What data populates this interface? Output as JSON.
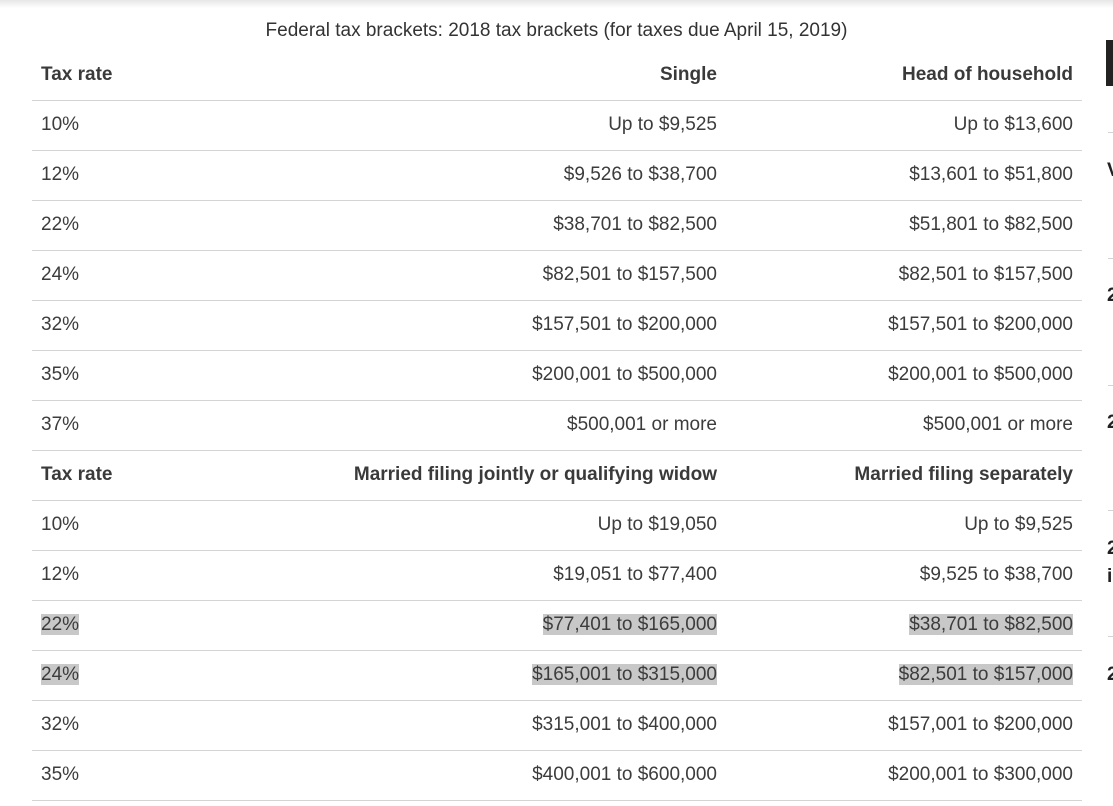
{
  "caption": "Federal tax brackets: 2018 tax brackets (for taxes due April 15, 2019)",
  "section1": {
    "headers": [
      "Tax rate",
      "Single",
      "Head of household"
    ],
    "rows": [
      [
        "10%",
        "Up to $9,525",
        "Up to $13,600"
      ],
      [
        "12%",
        "$9,526 to $38,700",
        "$13,601 to $51,800"
      ],
      [
        "22%",
        "$38,701 to $82,500",
        "$51,801 to $82,500"
      ],
      [
        "24%",
        "$82,501 to $157,500",
        "$82,501 to $157,500"
      ],
      [
        "32%",
        "$157,501 to $200,000",
        "$157,501 to $200,000"
      ],
      [
        "35%",
        "$200,001 to $500,000",
        "$200,001 to $500,000"
      ],
      [
        "37%",
        "$500,001 or more",
        "$500,001 or more"
      ]
    ]
  },
  "section2": {
    "headers": [
      "Tax rate",
      "Married filing jointly or qualifying widow",
      "Married filing separately"
    ],
    "rows": [
      [
        "10%",
        "Up to $19,050",
        "Up to $9,525"
      ],
      [
        "12%",
        "$19,051 to $77,400",
        "$9,525 to $38,700"
      ],
      [
        "22%",
        "$77,401 to $165,000",
        "$38,701 to $82,500"
      ],
      [
        "24%",
        "$165,001 to $315,000",
        "$82,501 to $157,000"
      ],
      [
        "32%",
        "$315,001 to $400,000",
        "$157,001 to $200,000"
      ],
      [
        "35%",
        "$400,001 to $600,000",
        "$200,001 to $300,000"
      ]
    ]
  },
  "colors": {
    "highlight": "#c8c8c8",
    "border": "#d4d4d4",
    "text": "#333333"
  },
  "edge_glyphs": [
    "V",
    "2",
    "2",
    "2",
    "i",
    "2"
  ]
}
